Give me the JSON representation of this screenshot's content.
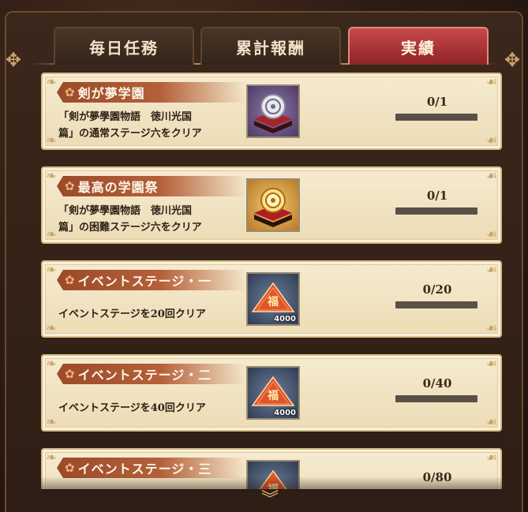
{
  "tabs": [
    {
      "label": "毎日任務",
      "active": false
    },
    {
      "label": "累計報酬",
      "active": false
    },
    {
      "label": "実績",
      "active": true
    }
  ],
  "achievements": [
    {
      "title": "剣が夢学園",
      "description_line1": "「剣が夢學園物語　徳川光国",
      "description_line2": "篇」の通常ステージ六をクリア",
      "reward_icon": "crest-on-cushion-icon",
      "reward_quantity": "",
      "progress": "0/1",
      "progress_fraction": 0
    },
    {
      "title": "最高の学園祭",
      "description_line1": "「剣が夢學園物語　徳川光国",
      "description_line2": "篇」の困難ステージ六をクリア",
      "reward_icon": "gold-crest-on-cushion-icon",
      "reward_quantity": "",
      "progress": "0/1",
      "progress_fraction": 0
    },
    {
      "title": "イベントステージ・一",
      "description_line1": "イベントステージを20回クリア",
      "description_line2": "",
      "reward_icon": "fuku-ticket-icon",
      "reward_icon_glyph": "福",
      "reward_quantity": "4000",
      "progress": "0/20",
      "progress_fraction": 0
    },
    {
      "title": "イベントステージ・二",
      "description_line1": "イベントステージを40回クリア",
      "description_line2": "",
      "reward_icon": "fuku-ticket-icon",
      "reward_icon_glyph": "福",
      "reward_quantity": "4000",
      "progress": "0/40",
      "progress_fraction": 0
    },
    {
      "title": "イベントステージ・三",
      "description_line1": "",
      "description_line2": "",
      "reward_icon": "fuku-ticket-icon",
      "reward_icon_glyph": "福",
      "reward_quantity": "",
      "progress": "0/80",
      "progress_fraction": 0
    }
  ],
  "colors": {
    "active_tab": "#b6393c",
    "card_background": "#f3e6c6",
    "ribbon": "#a8532f",
    "progress_track": "#5a5047"
  }
}
